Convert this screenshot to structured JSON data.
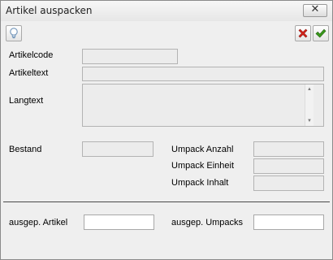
{
  "window": {
    "title": "Artikel auspacken",
    "close_glyph": "✕"
  },
  "toolbar": {
    "hint_icon": "lightbulb-icon",
    "cancel_icon": "red-x-icon",
    "confirm_icon": "green-check-icon"
  },
  "labels": {
    "artikelcode": "Artikelcode",
    "artikeltext": "Artikeltext",
    "langtext": "Langtext",
    "bestand": "Bestand",
    "umpack_anzahl": "Umpack Anzahl",
    "umpack_einheit": "Umpack Einheit",
    "umpack_inhalt": "Umpack Inhalt",
    "ausgep_artikel": "ausgep. Artikel",
    "ausgep_umpacks": "ausgep. Umpacks"
  },
  "fields": {
    "artikelcode": "",
    "artikeltext": "",
    "langtext": "",
    "bestand": "",
    "umpack_anzahl": "",
    "umpack_einheit": "",
    "umpack_inhalt": "",
    "ausgep_artikel": "",
    "ausgep_umpacks": ""
  },
  "colors": {
    "cancel": "#d9251c",
    "confirm": "#3a9a1c"
  }
}
